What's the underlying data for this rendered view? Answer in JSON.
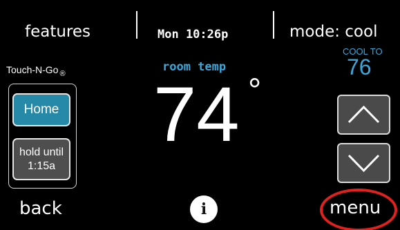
{
  "header": {
    "features_label": "features",
    "datetime": "Mon 10:26p",
    "mode_label": "mode: cool"
  },
  "brand": {
    "name": "Touch-N-Go",
    "registered": "®"
  },
  "left_panel": {
    "home_label": "Home",
    "hold_line1": "hold until",
    "hold_line2": "1:15a"
  },
  "main": {
    "room_label": "room temp",
    "room_temp": "74",
    "degree": "°"
  },
  "setpoint": {
    "label": "COOL TO",
    "value": "76"
  },
  "footer": {
    "back_label": "back",
    "info_label": "i",
    "menu_label": "menu"
  },
  "colors": {
    "accent_blue": "#3aa7da",
    "home_button": "#2689a8",
    "highlight_red": "#e0211d"
  }
}
